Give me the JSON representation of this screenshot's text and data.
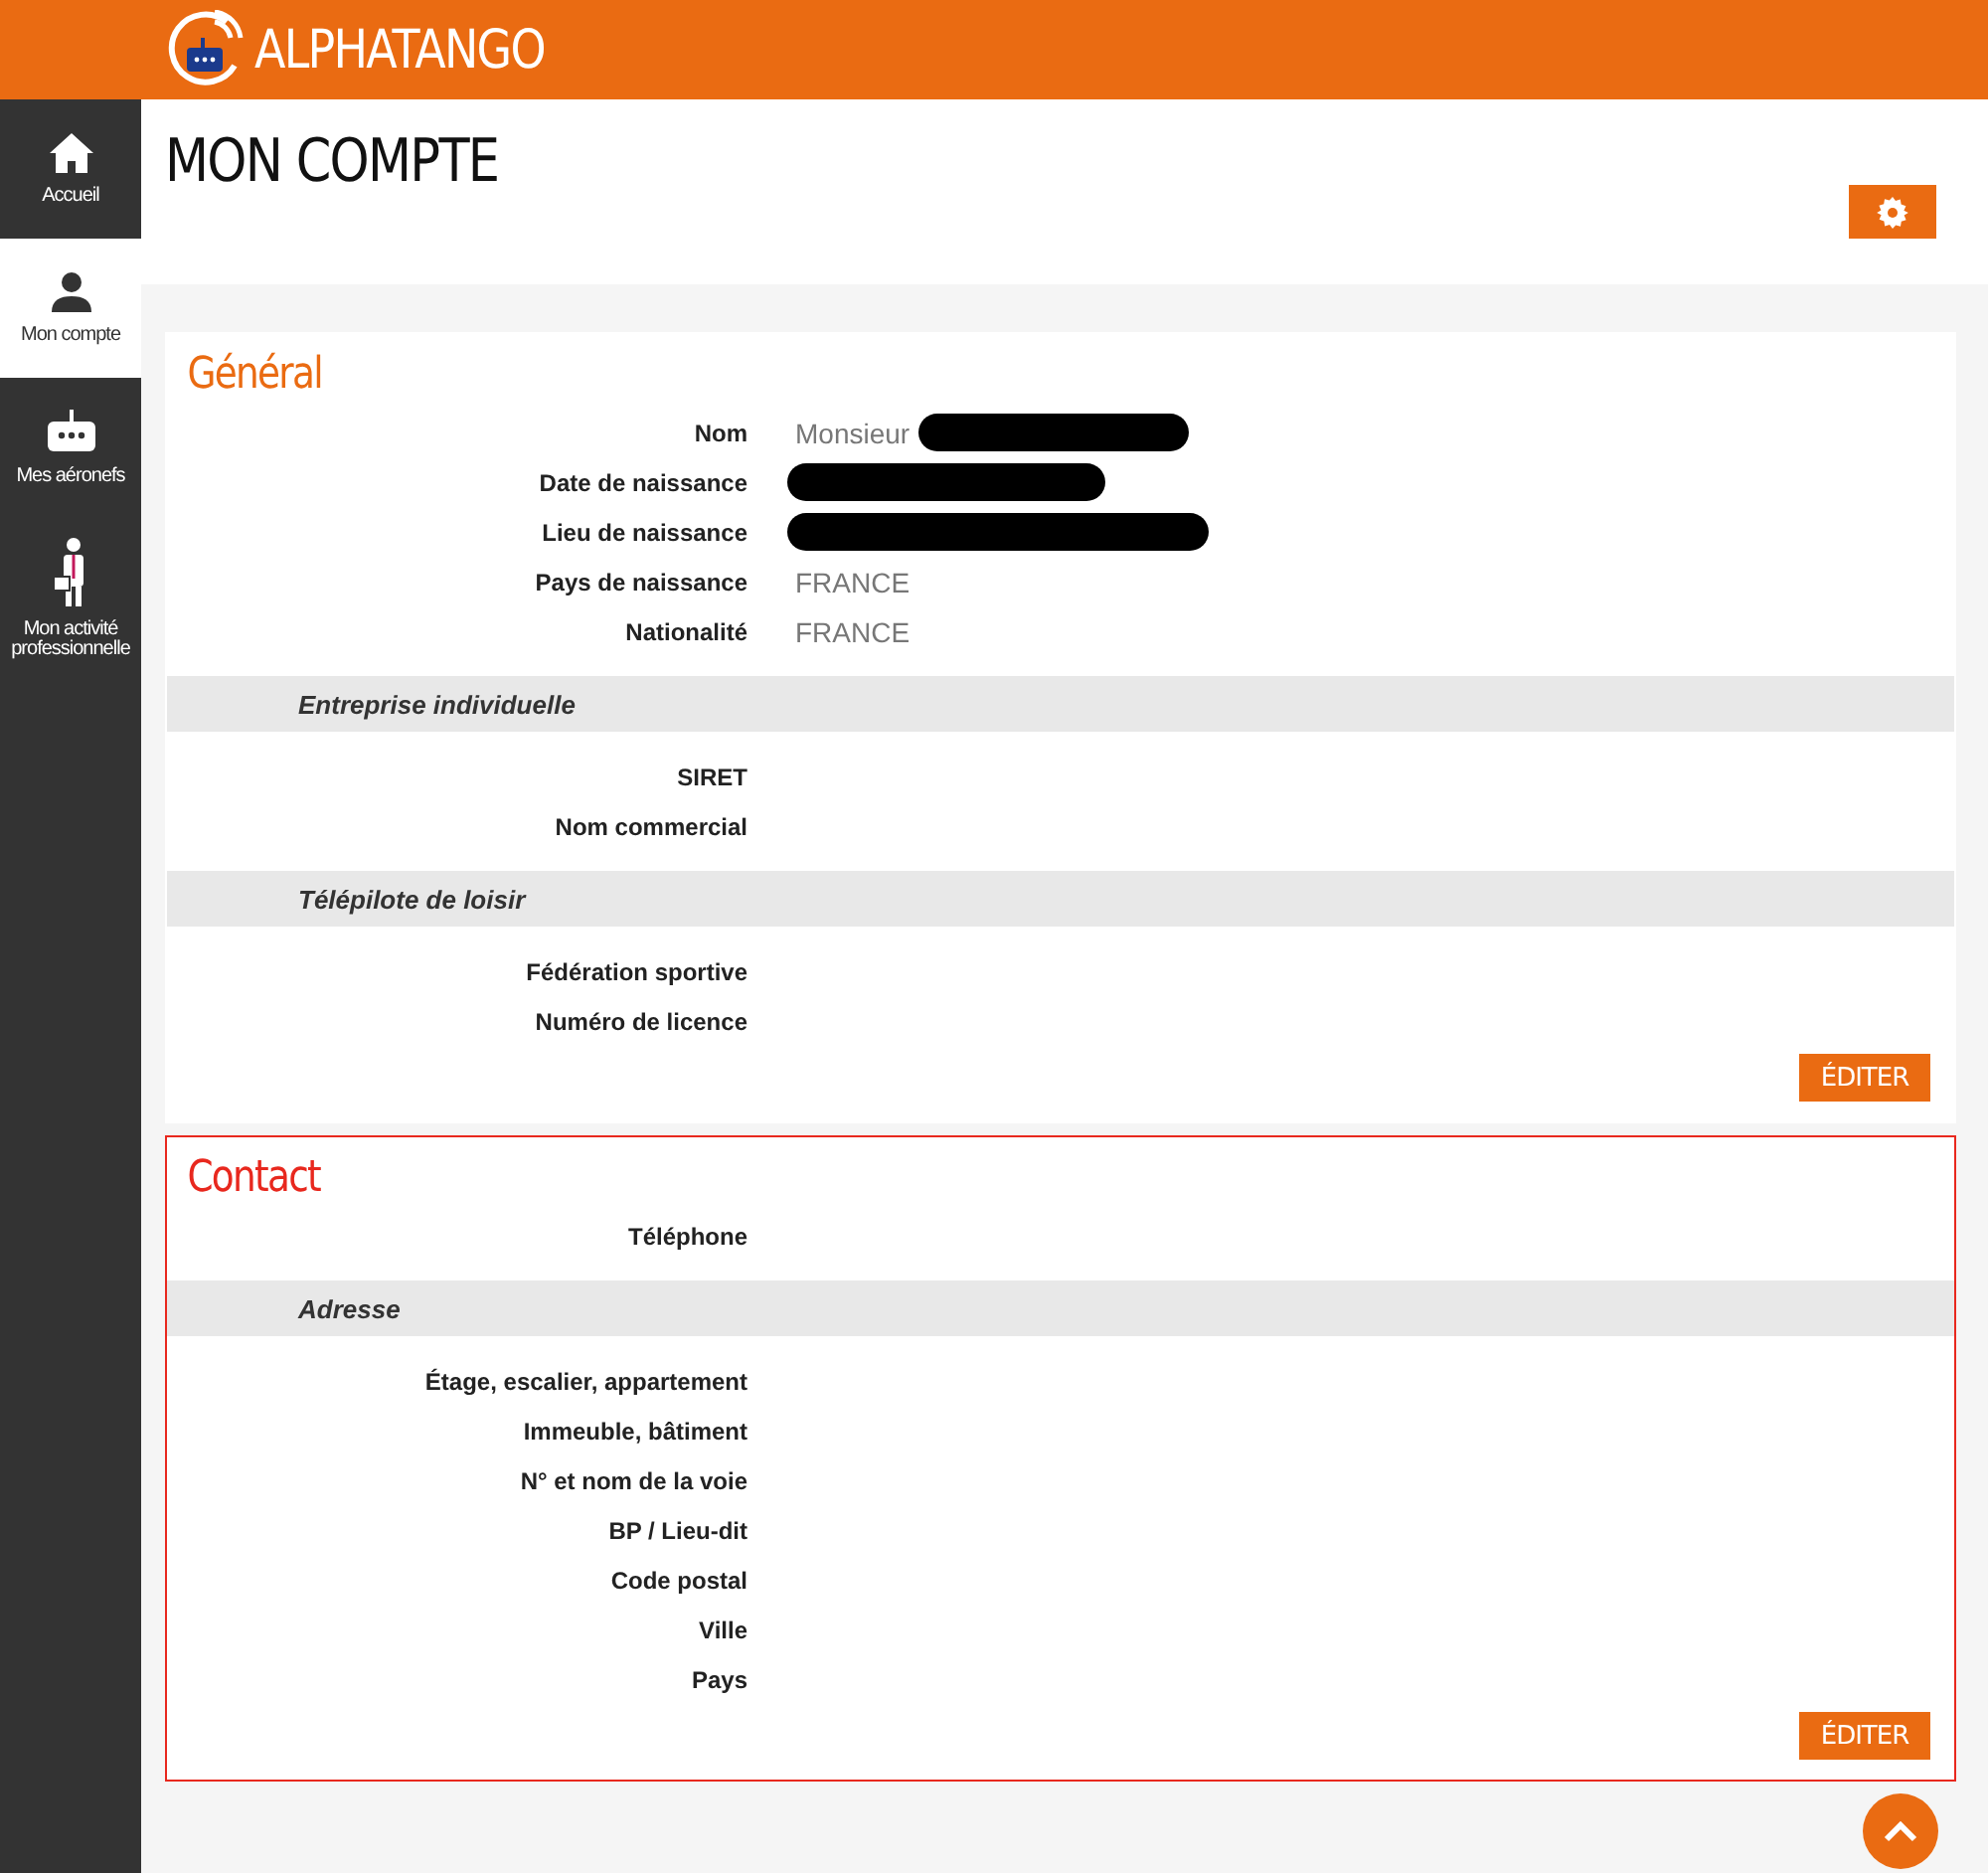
{
  "header": {
    "logo": "ALPHATANGO"
  },
  "sidebar": {
    "items": [
      {
        "label": "Accueil",
        "selected": false
      },
      {
        "label": "Mon compte",
        "selected": true
      },
      {
        "label": "Mes aéronefs",
        "selected": false
      },
      {
        "label": "Mon activité professionnelle",
        "selected": false
      }
    ]
  },
  "page": {
    "title": "MON COMPTE"
  },
  "sections": [
    {
      "title": "Général",
      "highlighted": false,
      "button": "ÉDITER",
      "groups": [
        {
          "fields": [
            {
              "label": "Nom",
              "value": "Monsieur",
              "redacted": true
            },
            {
              "label": "Date de naissance",
              "redacted": true
            },
            {
              "label": "Lieu de naissance",
              "redacted": true
            },
            {
              "label": "Pays de naissance",
              "value": "FRANCE"
            },
            {
              "label": "Nationalité",
              "value": "FRANCE"
            }
          ]
        },
        {
          "heading": "Entreprise individuelle",
          "fields": [
            {
              "label": "SIRET"
            },
            {
              "label": "Nom commercial"
            }
          ]
        },
        {
          "heading": "Télépilote de loisir",
          "fields": [
            {
              "label": "Fédération sportive"
            },
            {
              "label": "Numéro de licence"
            }
          ]
        }
      ]
    },
    {
      "title": "Contact",
      "highlighted": true,
      "button": "ÉDITER",
      "groups": [
        {
          "fields": [
            {
              "label": "Téléphone"
            }
          ]
        },
        {
          "heading": "Adresse",
          "fields": [
            {
              "label": "Étage, escalier, appartement"
            },
            {
              "label": "Immeuble, bâtiment"
            },
            {
              "label": "N° et nom de la voie"
            },
            {
              "label": "BP / Lieu-dit"
            },
            {
              "label": "Code postal"
            },
            {
              "label": "Ville"
            },
            {
              "label": "Pays"
            }
          ]
        }
      ]
    }
  ]
}
